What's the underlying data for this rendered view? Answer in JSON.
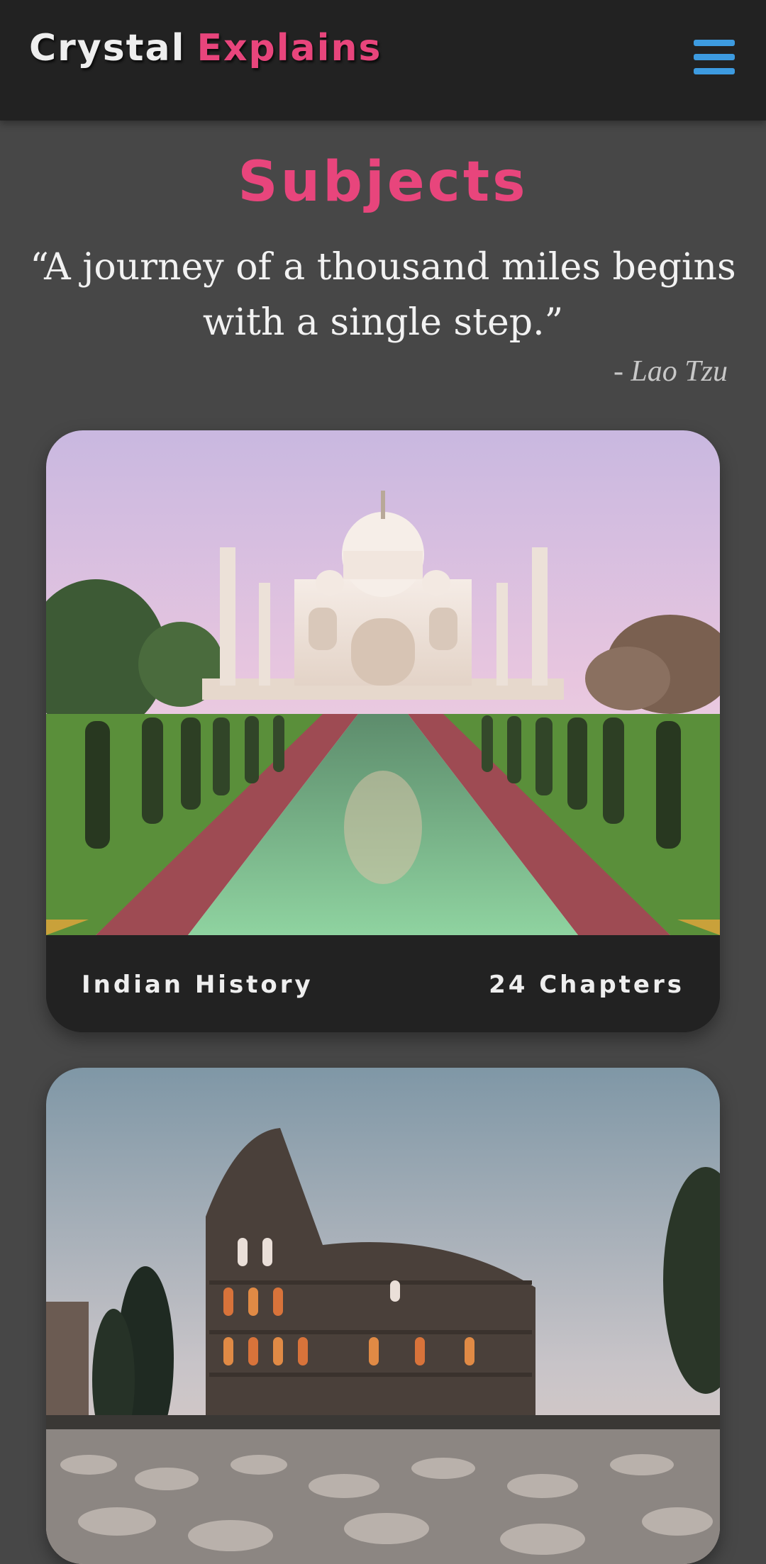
{
  "header": {
    "logo_word1": "Crystal",
    "logo_word2": "Explains",
    "menu_icon": "hamburger-menu-icon"
  },
  "page": {
    "title": "Subjects",
    "quote": "“A journey of a thousand miles begins with a single step.”",
    "author": "- Lao Tzu"
  },
  "subjects": [
    {
      "name": "Indian History",
      "chapters": "24 Chapters",
      "image": "taj-mahal-photo"
    },
    {
      "name": "",
      "chapters": "",
      "image": "colosseum-photo"
    }
  ],
  "colors": {
    "background": "#474747",
    "header": "#222222",
    "accent": "#e8457c",
    "menu": "#3d9be0",
    "card": "#222222"
  }
}
